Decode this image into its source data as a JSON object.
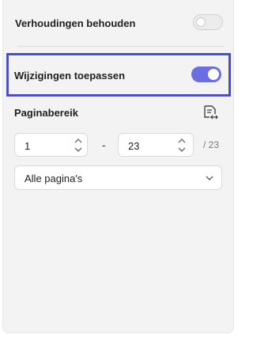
{
  "settings": {
    "keep_ratio": {
      "label": "Verhoudingen behouden",
      "enabled": false
    },
    "apply_changes": {
      "label": "Wijzigingen toepassen",
      "enabled": true
    }
  },
  "page_range": {
    "label": "Paginabereik",
    "from_value": "1",
    "separator": "-",
    "to_value": "23",
    "total": "/ 23",
    "selection": "Alle pagina's"
  },
  "icons": {
    "range": "page-range-icon",
    "up": "chevron-up-icon",
    "down": "chevron-down-icon"
  },
  "colors": {
    "accent": "#6a6ee0",
    "highlight_border": "#4a4fc4"
  }
}
